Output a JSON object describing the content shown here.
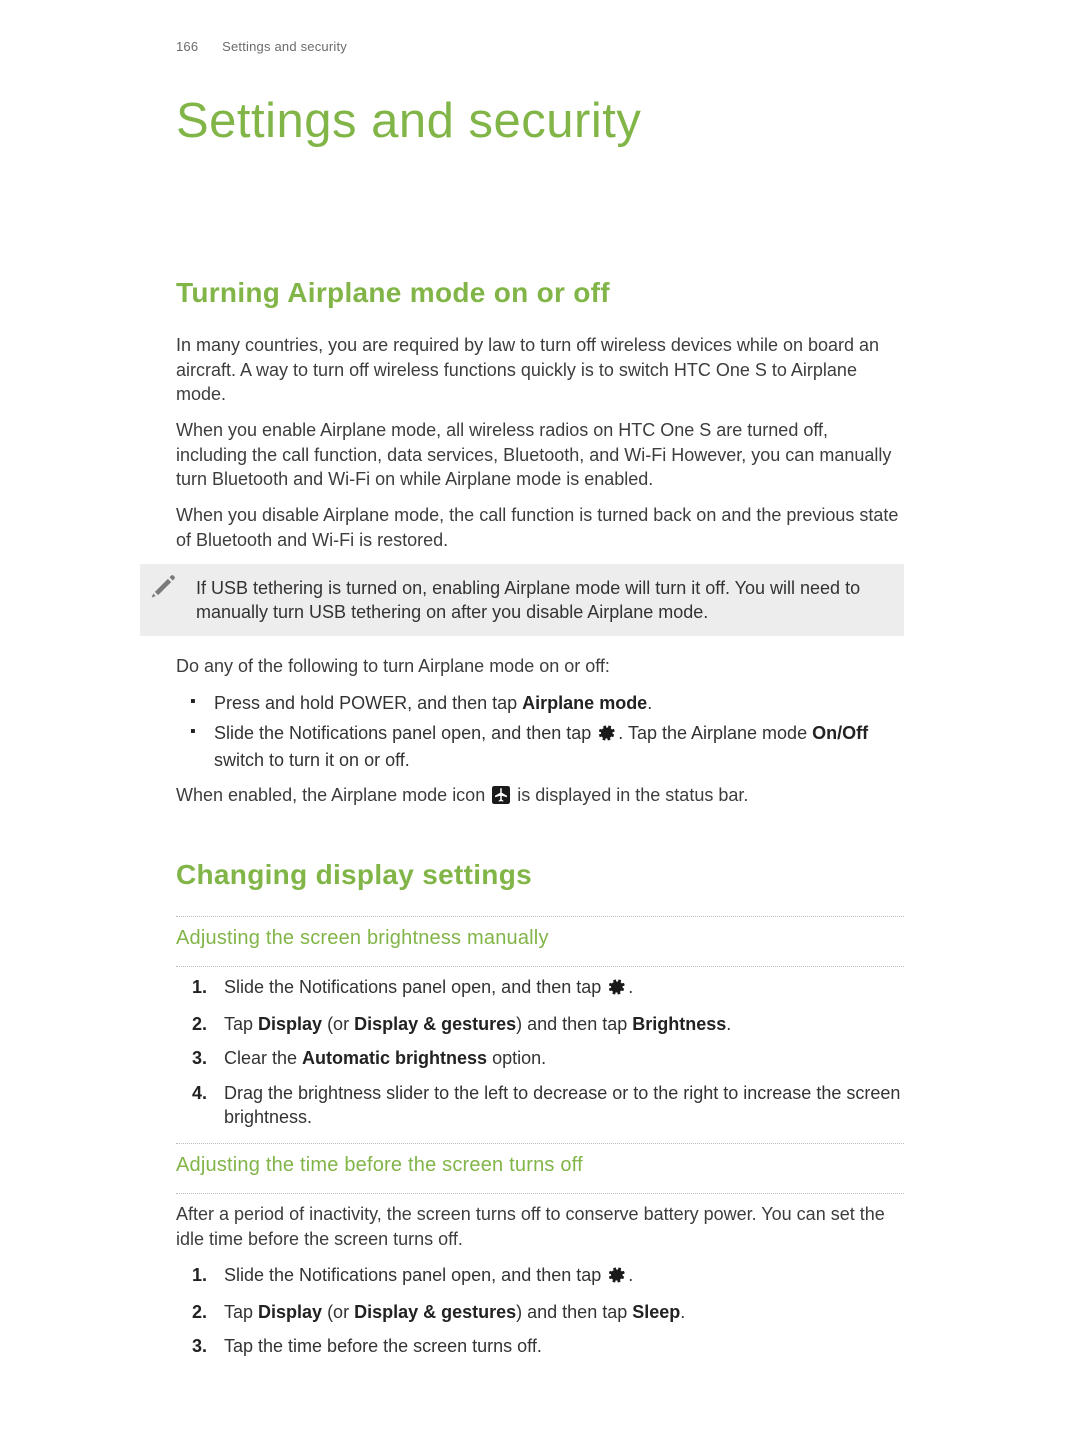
{
  "header": {
    "page_number": "166",
    "running_title": "Settings and security"
  },
  "title": "Settings and security",
  "section1": {
    "heading": "Turning Airplane mode on or off",
    "p1": "In many countries, you are required by law to turn off wireless devices while on board an aircraft. A way to turn off wireless functions quickly is to switch HTC One S to Airplane mode.",
    "p2": "When you enable Airplane mode, all wireless radios on HTC One S are turned off, including the call function, data services, Bluetooth, and Wi-Fi However, you can manually turn Bluetooth and Wi-Fi on while Airplane mode is enabled.",
    "p3": "When you disable Airplane mode, the call function is turned back on and the previous state of Bluetooth and Wi-Fi is restored.",
    "note": "If USB tethering is turned on, enabling Airplane mode will turn it off. You will need to manually turn USB tethering on after you disable Airplane mode.",
    "p4": "Do any of the following to turn Airplane mode on or off:",
    "bul1": {
      "pre": "Press and hold POWER, and then tap ",
      "kw": "Airplane mode",
      "post": "."
    },
    "bul2": {
      "a": "Slide the Notifications panel open, and then tap ",
      "b": ". Tap the Airplane mode ",
      "kw": "On/Off",
      "c": " switch to turn it on or off."
    },
    "p5": {
      "a": "When enabled, the Airplane mode icon ",
      "b": " is displayed in the status bar."
    }
  },
  "section2": {
    "heading": "Changing display settings",
    "sub1": {
      "heading": "Adjusting the screen brightness manually",
      "steps": {
        "s1a": "Slide the Notifications panel open, and then tap ",
        "s1b": ".",
        "s2a": "Tap ",
        "s2kw1": "Display",
        "s2b": " (or ",
        "s2kw2": "Display & gestures",
        "s2c": ") and then tap ",
        "s2kw3": "Brightness",
        "s2d": ".",
        "s3a": "Clear the ",
        "s3kw": "Automatic brightness",
        "s3b": " option.",
        "s4": "Drag the brightness slider to the left to decrease or to the right to increase the screen brightness."
      }
    },
    "sub2": {
      "heading": "Adjusting the time before the screen turns off",
      "p": "After a period of inactivity, the screen turns off to conserve battery power. You can set the idle time before the screen turns off.",
      "steps": {
        "s1a": "Slide the Notifications panel open, and then tap ",
        "s1b": ".",
        "s2a": "Tap ",
        "s2kw1": "Display",
        "s2b": " (or ",
        "s2kw2": "Display & gestures",
        "s2c": ") and then tap ",
        "s2kw3": "Sleep",
        "s2d": ".",
        "s3": "Tap the time before the screen turns off."
      }
    }
  }
}
